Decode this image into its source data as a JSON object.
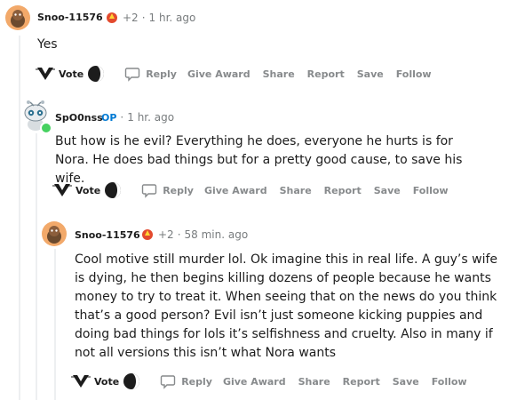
{
  "comments": [
    {
      "username": "Snoo-11576",
      "award_count": "+2",
      "time": "1 hr. ago",
      "body": "Yes",
      "actions": {
        "vote": "Vote",
        "reply": "Reply",
        "give_award": "Give Award",
        "share": "Share",
        "report": "Report",
        "save": "Save",
        "follow": "Follow"
      }
    },
    {
      "username": "SpO0nss",
      "op_badge": "OP",
      "time": "1 hr. ago",
      "body": "But how is he evil? Everything he does, everyone he hurts is for Nora. He does bad things but for a pretty good cause, to save his wife.",
      "actions": {
        "vote": "Vote",
        "reply": "Reply",
        "give_award": "Give Award",
        "share": "Share",
        "report": "Report",
        "save": "Save",
        "follow": "Follow"
      }
    },
    {
      "username": "Snoo-11576",
      "award_count": "+2",
      "time": "58 min. ago",
      "body": "Cool motive still murder lol. Ok imagine this in real life. A guy’s wife is dying, he then begins killing dozens of people because he wants money to try to treat it. When seeing that on the news do you think that’s a good person? Evil isn’t just someone kicking puppies and doing bad things for lols it’s selfishness and cruelty. Also in many if not all versions this isn’t what Nora wants",
      "actions": {
        "vote": "Vote",
        "reply": "Reply",
        "give_award": "Give Award",
        "share": "Share",
        "report": "Report",
        "save": "Save",
        "follow": "Follow"
      }
    }
  ],
  "separator": "·",
  "colors": {
    "username": "#1c1c1c",
    "meta": "#787c7e",
    "op": "#0079d3",
    "action": "#878a8c",
    "thread_line": "#edeff1",
    "online_dot": "#46d160",
    "avatar_orange": "#f2a96a"
  }
}
